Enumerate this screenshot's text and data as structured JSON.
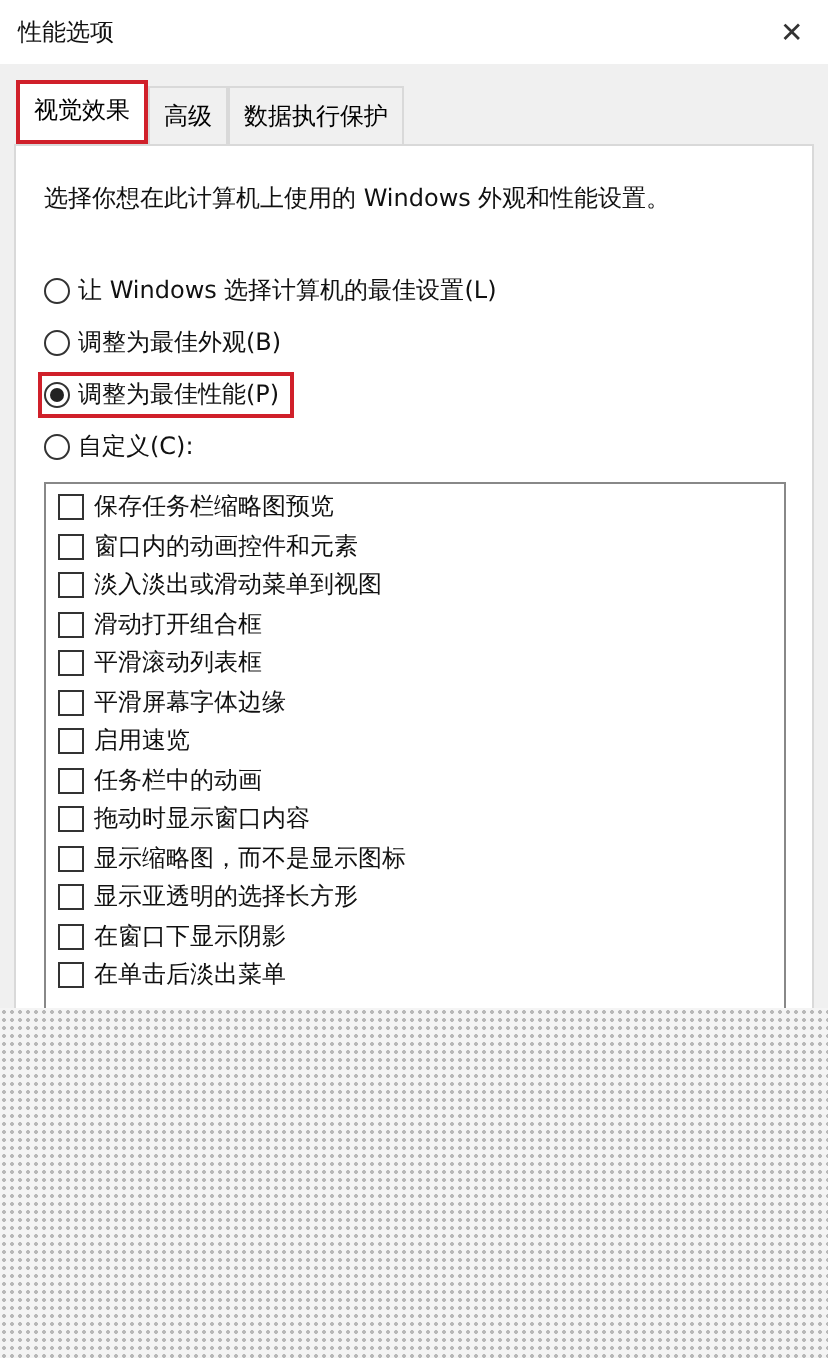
{
  "window": {
    "title": "性能选项",
    "close": "✕"
  },
  "tabs": [
    {
      "label": "视觉效果",
      "selected": true,
      "highlighted": true
    },
    {
      "label": "高级",
      "selected": false,
      "highlighted": false
    },
    {
      "label": "数据执行保护",
      "selected": false,
      "highlighted": false
    }
  ],
  "description": "选择你想在此计算机上使用的 Windows 外观和性能设置。",
  "options": [
    {
      "label": "让 Windows 选择计算机的最佳设置(L)",
      "selected": false,
      "highlighted": false
    },
    {
      "label": "调整为最佳外观(B)",
      "selected": false,
      "highlighted": false
    },
    {
      "label": "调整为最佳性能(P)",
      "selected": true,
      "highlighted": true
    },
    {
      "label": "自定义(C):",
      "selected": false,
      "highlighted": false
    }
  ],
  "effects": [
    {
      "label": "保存任务栏缩略图预览",
      "checked": false
    },
    {
      "label": "窗口内的动画控件和元素",
      "checked": false
    },
    {
      "label": "淡入淡出或滑动菜单到视图",
      "checked": false
    },
    {
      "label": "滑动打开组合框",
      "checked": false
    },
    {
      "label": "平滑滚动列表框",
      "checked": false
    },
    {
      "label": "平滑屏幕字体边缘",
      "checked": false
    },
    {
      "label": "启用速览",
      "checked": false
    },
    {
      "label": "任务栏中的动画",
      "checked": false
    },
    {
      "label": "拖动时显示窗口内容",
      "checked": false
    },
    {
      "label": "显示缩略图，而不是显示图标",
      "checked": false
    },
    {
      "label": "显示亚透明的选择长方形",
      "checked": false
    },
    {
      "label": "在窗口下显示阴影",
      "checked": false
    },
    {
      "label": "在单击后淡出菜单",
      "checked": false
    }
  ]
}
